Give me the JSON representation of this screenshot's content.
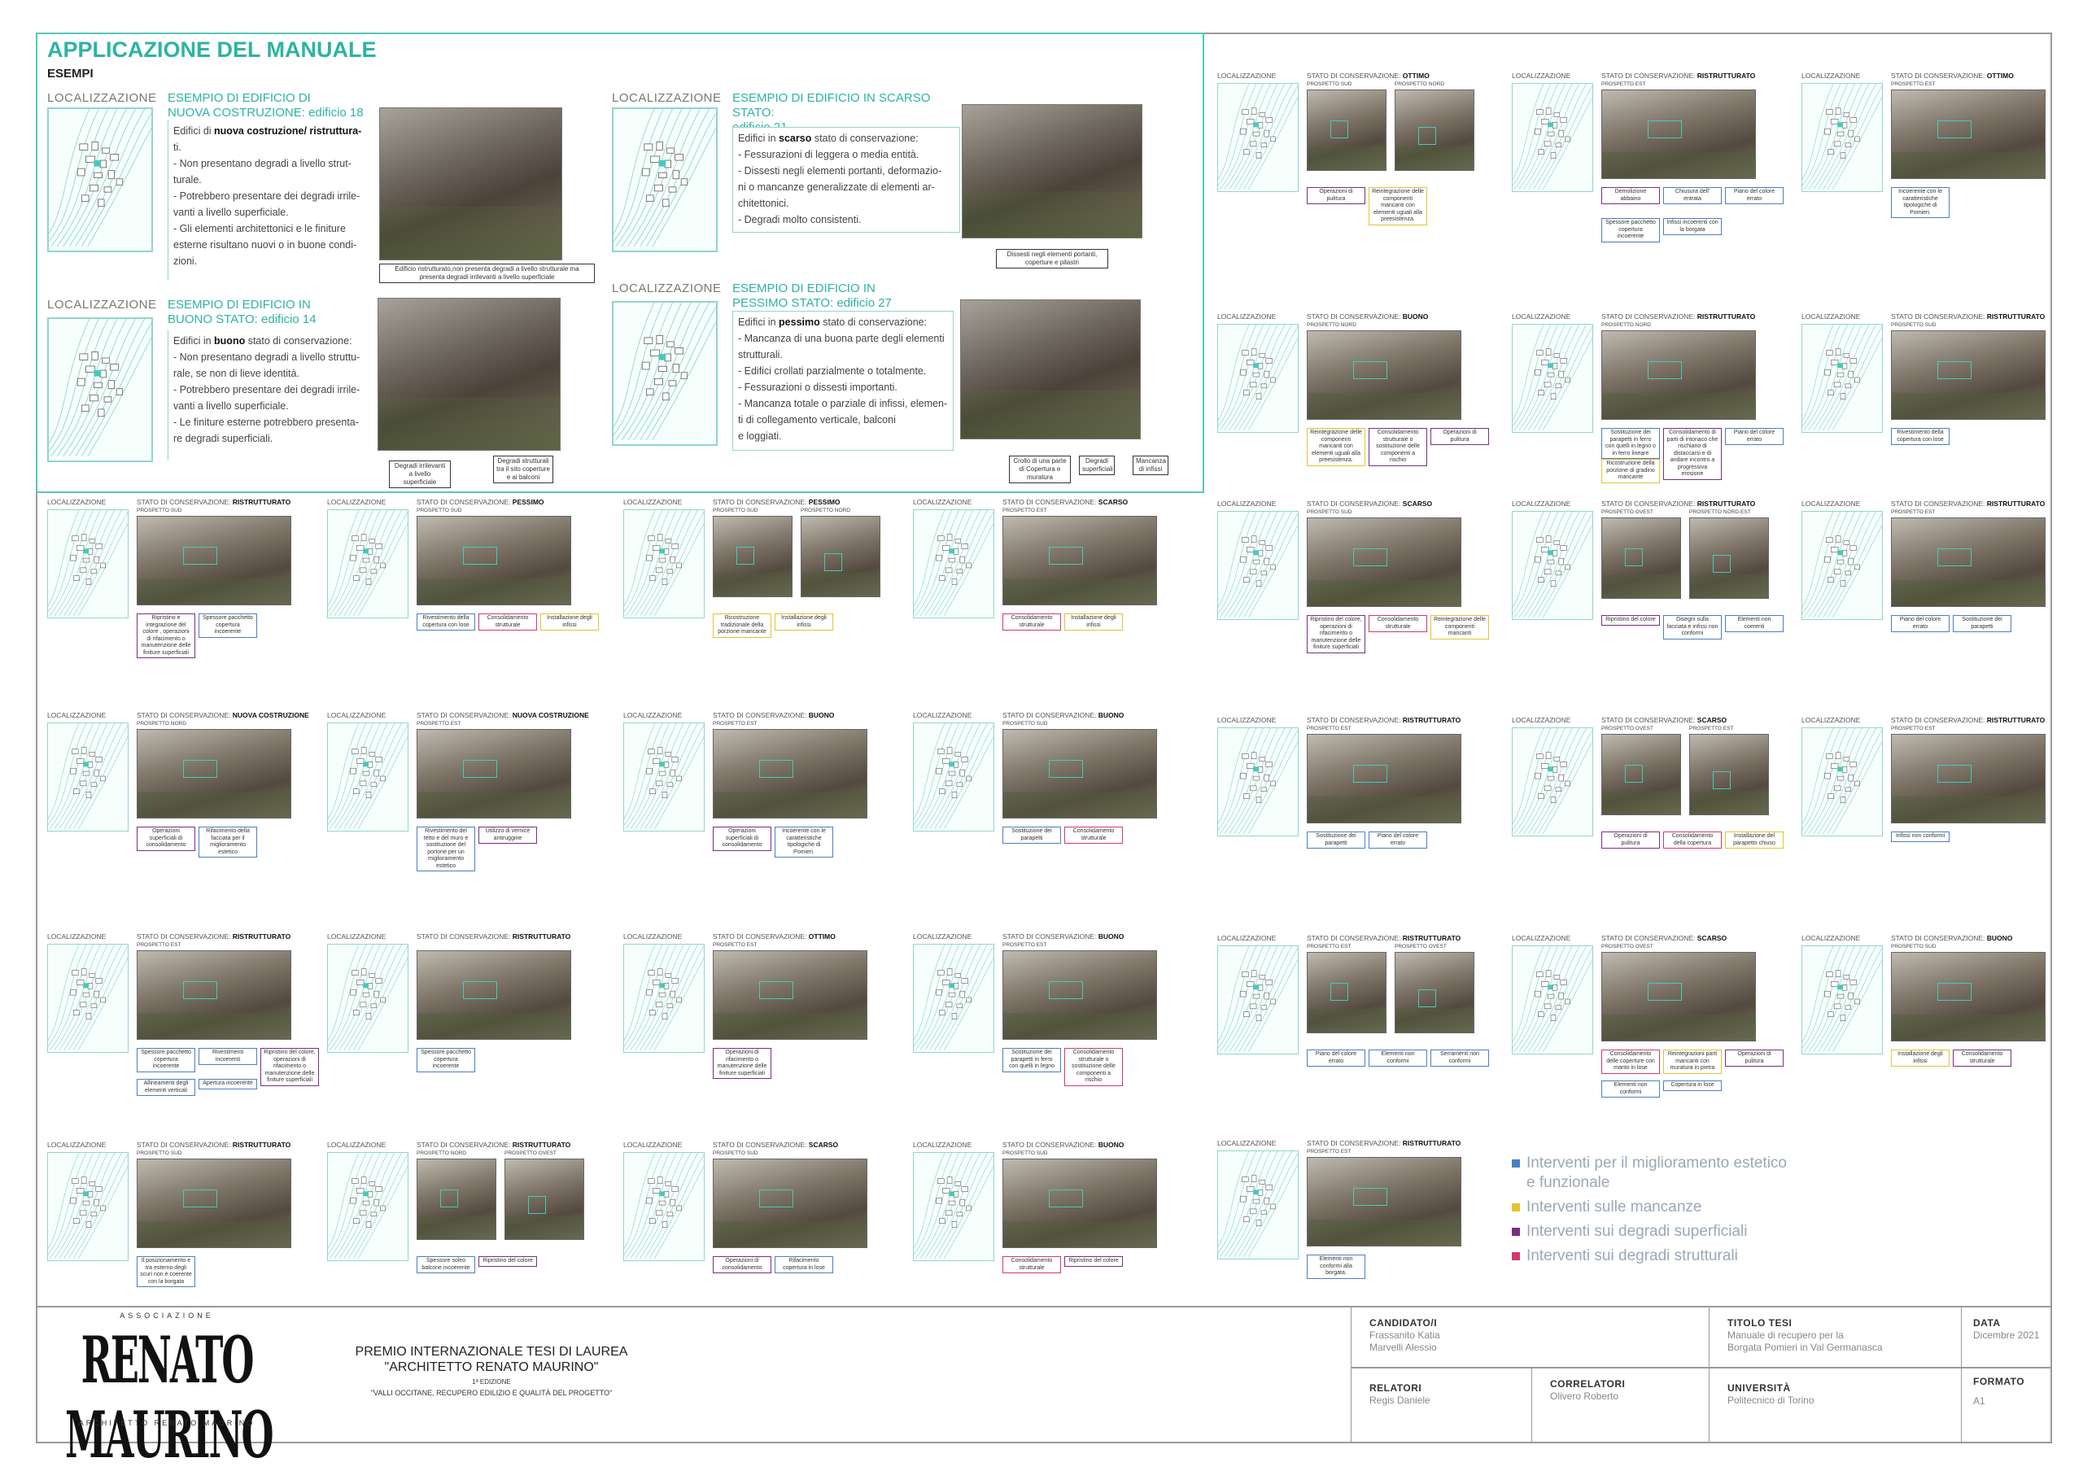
{
  "header": {
    "title": "APPLICAZIONE DEL MANUALE",
    "subtitle": "ESEMPI"
  },
  "examples": [
    {
      "loc": "LOCALIZZAZIONE",
      "title_a": "ESEMPIO DI EDIFICIO DI",
      "title_b": "NUOVA COSTRUZIONE: edificio 18",
      "lines": [
        "Edifici di nuova costruzione/ ristruttura-",
        "ti.",
        "- Non presentano degradi a livello strut-",
        "turale.",
        "- Potrebbero presentare dei degradi irrile-",
        "vanti a livello superficiale.",
        "- Gli elementi architettonici e le finiture",
        "esterne risultano nuovi o in buone condi-",
        "zioni."
      ],
      "captions": [
        "Edificio ristrutturato,non presenta degradi a livello strutturale ma presenta degradi irrilevanti a livello superficiale"
      ]
    },
    {
      "loc": "LOCALIZZAZIONE",
      "title_a": "ESEMPIO DI EDIFICIO IN SCARSO STATO:",
      "title_b": "edificio 21",
      "lines": [
        "Edifici in scarso stato di conservazione:",
        "- Fessurazioni di leggera o media entità.",
        "- Dissesti negli elementi portanti, deformazio-",
        "ni o mancanze generalizzate di elementi ar-",
        "chitettonici.",
        "- Degradi molto consistenti."
      ],
      "captions": [
        "Dissesti negli elementi portanti, coperture e pilastri"
      ]
    },
    {
      "loc": "LOCALIZZAZIONE",
      "title_a": "ESEMPIO DI EDIFICIO IN",
      "title_b": "BUONO STATO: edificio 14",
      "lines": [
        "Edifici in buono stato di conservazione:",
        "- Non presentano degradi a livello struttu-",
        "rale, se non di lieve identità.",
        "- Potrebbero presentare dei degradi irrile-",
        "vanti a livello superficiale.",
        "- Le finiture esterne potrebbero presenta-",
        "re degradi superficiali."
      ],
      "captions": [
        "Degradi irrilevanti a livello superficiale",
        "Degradi strutturali tra il sito coperture e ai balconi"
      ]
    },
    {
      "loc": "LOCALIZZAZIONE",
      "title_a": "ESEMPIO DI EDIFICIO IN",
      "title_b": "PESSIMO STATO: edificio 27",
      "lines": [
        "Edifici in pessimo stato di conservazione:",
        "- Mancanza di una buona parte degli elementi",
        "strutturali.",
        "- Edifici crollati parzialmente o totalmente.",
        "- Fessurazioni o dissesti importanti.",
        "- Mancanza totale o parziale di infissi, elemen-",
        "ti di collegamento verticale, balconi",
        "e loggiati."
      ],
      "captions": [
        "Crollo di una parte di Copertura e muratura",
        "Degradi superficiali",
        "Mancanza di infissi"
      ]
    }
  ],
  "card_labels": {
    "loc": "LOCALIZZAZIONE",
    "state_prefix": "STATO DI CONSERVAZIONE:"
  },
  "cards": [
    {
      "state": "OTTIMO",
      "p": [
        "PROSPETTO SUD",
        "PROSPETTO NORD"
      ],
      "notes": [
        [
          "Operazioni di pulitura",
          "purple"
        ],
        [
          "Reintegrazione delle componenti mancanti con elementi uguali alla preesistenza.",
          "yellow"
        ]
      ]
    },
    {
      "state": "RISTRUTTURATO",
      "p": [
        "PROSPETTO EST"
      ],
      "notes": [
        [
          "Demolizione abbaino",
          "purple"
        ],
        [
          "Chiusura dell' entrata",
          "blue"
        ],
        [
          "Piano del colore errato",
          "blue"
        ],
        [
          "Spessore pacchetto copertura incoerente",
          "blue"
        ],
        [
          "Infissi incoerenti con la borgata",
          "blue"
        ]
      ]
    },
    {
      "state": "OTTIMO",
      "p": [
        "PROSPETTO EST"
      ],
      "notes": [
        [
          "Incoerente con le caratteristiche tipologiche di Pomieri.",
          "blue"
        ]
      ]
    },
    {
      "state": "BUONO",
      "p": [
        "PROSPETTO NORD"
      ],
      "notes": [
        [
          "Reintegrazione delle componenti mancanti con elementi uguali alla preesistenza.",
          "yellow"
        ],
        [
          "Consolidamento strutturale o sostituzione delle componenti a rischio",
          "purple"
        ],
        [
          "Operazioni di pulitura",
          "purple"
        ]
      ]
    },
    {
      "state": "RISTRUTTURATO",
      "p": [
        "PROSPETTO NORD"
      ],
      "notes": [
        [
          "Sostituzione dei parapetti in ferro con quelli in legno o in ferro lineare",
          "blue"
        ],
        [
          "Consolidamento di parti di intonaco che rischiano di distaccarsi e di andare incontro a progressiva erosione",
          "purple"
        ],
        [
          "Piano del colore errato",
          "blue"
        ],
        [
          "Ricostruzione della porzione di gradino mancante",
          "yellow"
        ]
      ]
    },
    {
      "state": "RISTRUTTURATO",
      "p": [
        "PROSPETTO SUD"
      ],
      "notes": [
        [
          "Rivestimento della copertura con lose",
          "blue"
        ]
      ]
    },
    {
      "state": "SCARSO",
      "p": [
        "PROSPETTO SUD"
      ],
      "notes": [
        [
          "Ripristino del colore, operazioni di rifacimento o manutenzione delle finiture superficiali",
          "purple"
        ],
        [
          "Consolidamento strutturale",
          "pink"
        ],
        [
          "Reintegrazione delle componenti mancanti",
          "yellow"
        ]
      ]
    },
    {
      "state": "RISTRUTTURATO",
      "p": [
        "PROSPETTO OVEST",
        "PROSPETTO NORD-EST"
      ],
      "notes": [
        [
          "Ripristino del colore",
          "purple"
        ],
        [
          "Disegni sulla facciata e infissi non conformi",
          "blue"
        ],
        [
          "Elementi non coerenti",
          "blue"
        ]
      ]
    },
    {
      "state": "RISTRUTTURATO",
      "p": [
        "PROSPETTO EST"
      ],
      "notes": [
        [
          "Piano del colore errato",
          "blue"
        ],
        [
          "Sostituzione dei parapetti",
          "blue"
        ]
      ]
    },
    {
      "state": "RISTRUTTURATO",
      "p": [
        "PROSPETTO EST"
      ],
      "notes": [
        [
          "Sostituzione dei parapetti",
          "blue"
        ],
        [
          "Piano del colore errato",
          "blue"
        ]
      ]
    },
    {
      "state": "SCARSO",
      "p": [
        "PROSPETTO OVEST",
        "PROSPETTO EST"
      ],
      "notes": [
        [
          "Operazioni di pulitura",
          "purple"
        ],
        [
          "Consolidamento della copertura",
          "pink"
        ],
        [
          "Installazione del parapetto chiuso",
          "yellow"
        ]
      ]
    },
    {
      "state": "RISTRUTTURATO",
      "p": [
        "PROSPETTO EST"
      ],
      "notes": [
        [
          "Infissi non conformi",
          "blue"
        ]
      ]
    },
    {
      "state": "RISTRUTTURATO",
      "p": [
        "PROSPETTO EST",
        "PROSPETTO OVEST"
      ],
      "notes": [
        [
          "Piano del colore errato",
          "blue"
        ],
        [
          "Elementi non conformi",
          "blue"
        ],
        [
          "Serramenti non conformi",
          "blue"
        ]
      ]
    },
    {
      "state": "SCARSO",
      "p": [
        "PROSPETTO OVEST"
      ],
      "notes": [
        [
          "Consolidamento delle coperture con manto in lose",
          "pink"
        ],
        [
          "Reintegrazioni parti mancanti con muratura in pietra",
          "yellow"
        ],
        [
          "Operazioni di pulitura",
          "purple"
        ],
        [
          "Elementi non conformi",
          "blue"
        ],
        [
          "Copertura in lose",
          "blue"
        ]
      ]
    },
    {
      "state": "BUONO",
      "p": [
        "PROSPETTO SUD"
      ],
      "notes": [
        [
          "Installazione degli infissi",
          "yellow"
        ],
        [
          "Consolidamento strutturale",
          "purple"
        ]
      ]
    },
    {
      "state": "RISTRUTTURATO",
      "p": [
        "PROSPETTO EST"
      ],
      "notes": [
        [
          "Elementi non conformi alla borgata.",
          "blue"
        ]
      ]
    },
    {
      "state": "RISTRUTTURATO",
      "p": [
        "PROSPETTO SUD"
      ],
      "notes": [
        [
          "Ripristino e integrazione del colore , operazioni di rifacimento o manutenzione delle finiture superficiali",
          "purple"
        ],
        [
          "Spessore pacchetto copertura incoerente",
          "blue"
        ]
      ]
    },
    {
      "state": "PESSIMO",
      "p": [
        "PROSPETTO SUD"
      ],
      "notes": [
        [
          "Rivestimento della copertura con lose",
          "blue"
        ],
        [
          "Consolidamento strutturale",
          "pink"
        ],
        [
          "Installazione degli infissi",
          "yellow"
        ]
      ]
    },
    {
      "state": "PESSIMO",
      "p": [
        "PROSPETTO SUD",
        "PROSPETTO NORD"
      ],
      "notes": [
        [
          "Ricostruzione tradizionale della porzione mancante",
          "yellow"
        ],
        [
          "Installazione degli infissi",
          "yellow"
        ]
      ]
    },
    {
      "state": "SCARSO",
      "p": [
        "PROSPETTO EST"
      ],
      "notes": [
        [
          "Consolidamento strutturale",
          "pink"
        ],
        [
          "Installazione degli infissi",
          "yellow"
        ]
      ]
    },
    {
      "state": "NUOVA COSTRUZIONE",
      "p": [
        "PROSPETTO NORD"
      ],
      "notes": [
        [
          "Operazioni superficiali di consolidamento",
          "purple"
        ],
        [
          "Rifacimento della facciata per il miglioramento estetico",
          "blue"
        ]
      ]
    },
    {
      "state": "NUOVA COSTRUZIONE",
      "p": [
        "PROSPETTO EST"
      ],
      "notes": [
        [
          "Rivestimento del tetto e del muro e sostituzione del portone per un miglioramento estetico",
          "blue"
        ],
        [
          "Utilizzo di vernice antiruggine",
          "purple"
        ]
      ]
    },
    {
      "state": "BUONO",
      "p": [
        "PROSPETTO EST"
      ],
      "notes": [
        [
          "Operazioni superficiali di consolidamento",
          "purple"
        ],
        [
          "Incoerente con le caratteristiche tipologiche di Pomieri.",
          "blue"
        ]
      ]
    },
    {
      "state": "BUONO",
      "p": [
        "PROSPETTO SUD"
      ],
      "notes": [
        [
          "Sostituzione dei parapetti",
          "blue"
        ],
        [
          "Consolidamento strutturale",
          "pink"
        ]
      ]
    },
    {
      "state": "RISTRUTTURATO",
      "p": [
        "PROSPETTO EST"
      ],
      "notes": [
        [
          "Spessore pacchetto copertura incoerente",
          "blue"
        ],
        [
          "Rivestimenti incoerenti",
          "blue"
        ],
        [
          "Ripristino del colore, operazioni di rifacimento o manutenzione delle finiture superficiali",
          "purple"
        ],
        [
          "Allineamenti degli elementi verticali",
          "blue"
        ],
        [
          "Apertura incoerente",
          "blue"
        ]
      ]
    },
    {
      "state": "RISTRUTTURATO",
      "p": [],
      "notes": [
        [
          "Spessore pacchetto copertura incoerente",
          "blue"
        ]
      ]
    },
    {
      "state": "OTTIMO",
      "p": [
        "PROSPETTO EST"
      ],
      "notes": [
        [
          "Operazioni di rifacimento o manutenzione delle finiture superficiali",
          "purple"
        ]
      ]
    },
    {
      "state": "BUONO",
      "p": [
        "PROSPETTO EST"
      ],
      "notes": [
        [
          "Sostituzione dei parapetti in ferro con quelli in legno",
          "blue"
        ],
        [
          "Consolidamento strutturale o sostituzione delle componenti a rischio",
          "pink"
        ]
      ]
    },
    {
      "state": "RISTRUTTURATO",
      "p": [
        "PROSPETTO SUD"
      ],
      "notes": [
        [
          "Il posizionamento e tra esterno degli scuri non è coerente con la borgata",
          "blue"
        ]
      ]
    },
    {
      "state": "RISTRUTTURATO",
      "p": [
        "PROSPETTO NORD",
        "PROSPETTO OVEST"
      ],
      "notes": [
        [
          "Spessore soleo balcone incoerente",
          "blue"
        ],
        [
          "Ripristino del colore",
          "purple"
        ]
      ]
    },
    {
      "state": "SCARSO",
      "p": [
        "PROSPETTO SUD"
      ],
      "notes": [
        [
          "Operazioni di consolidamento",
          "purple"
        ],
        [
          "Rifacimento copertura in lose",
          "blue"
        ]
      ]
    },
    {
      "state": "BUONO",
      "p": [
        "PROSPETTO SUD"
      ],
      "notes": [
        [
          "Consolidamento strutturale",
          "pink"
        ],
        [
          "Ripristino del colore",
          "purple"
        ]
      ]
    }
  ],
  "legend": [
    {
      "label": "Interventi per il miglioramento estetico",
      "label2": "e funzionale",
      "color": "#4a7fc0"
    },
    {
      "label": "Interventi sulle mancanze",
      "label2": "",
      "color": "#e5c233"
    },
    {
      "label": "Interventi sui degradi superficiali",
      "label2": "",
      "color": "#7a2e85"
    },
    {
      "label": "Interventi sui degradi strutturali",
      "label2": "",
      "color": "#d23a6a"
    }
  ],
  "footer": {
    "assoc": "ASSOCIAZIONE",
    "logo_text": "RENATO MAURINO",
    "logo_sub": "ARCHITETTO RENATO MAURINO",
    "prize_1": "PREMIO INTERNAZIONALE  TESI DI LAUREA",
    "prize_2": "\"ARCHITETTO RENATO MAURINO\"",
    "prize_3": "1ª EDIZIONE",
    "prize_4": "\"VALLI OCCITANE, RECUPERO EDILIZIO E QUALITÀ DEL PROGETTO\"",
    "candidati_label": "CANDIDATO/I",
    "candidati": [
      "Frassanito Katia",
      "Marvelli Alessio"
    ],
    "titolo_label": "TITOLO TESI",
    "titolo": [
      "Manuale di recupero per la",
      "Borgata Pomieri in Val Germanasca"
    ],
    "data_label": "DATA",
    "data": "Dicembre 2021",
    "relatori_label": "RELATORI",
    "relatori": "Regis Daniele",
    "correlatori_label": "CORRELATORI",
    "correlatori": "Olivero Roberto",
    "universita_label": "UNIVERSITÀ",
    "universita": "Politecnico di Torino",
    "formato_label": "FORMATO",
    "formato": "A1"
  }
}
